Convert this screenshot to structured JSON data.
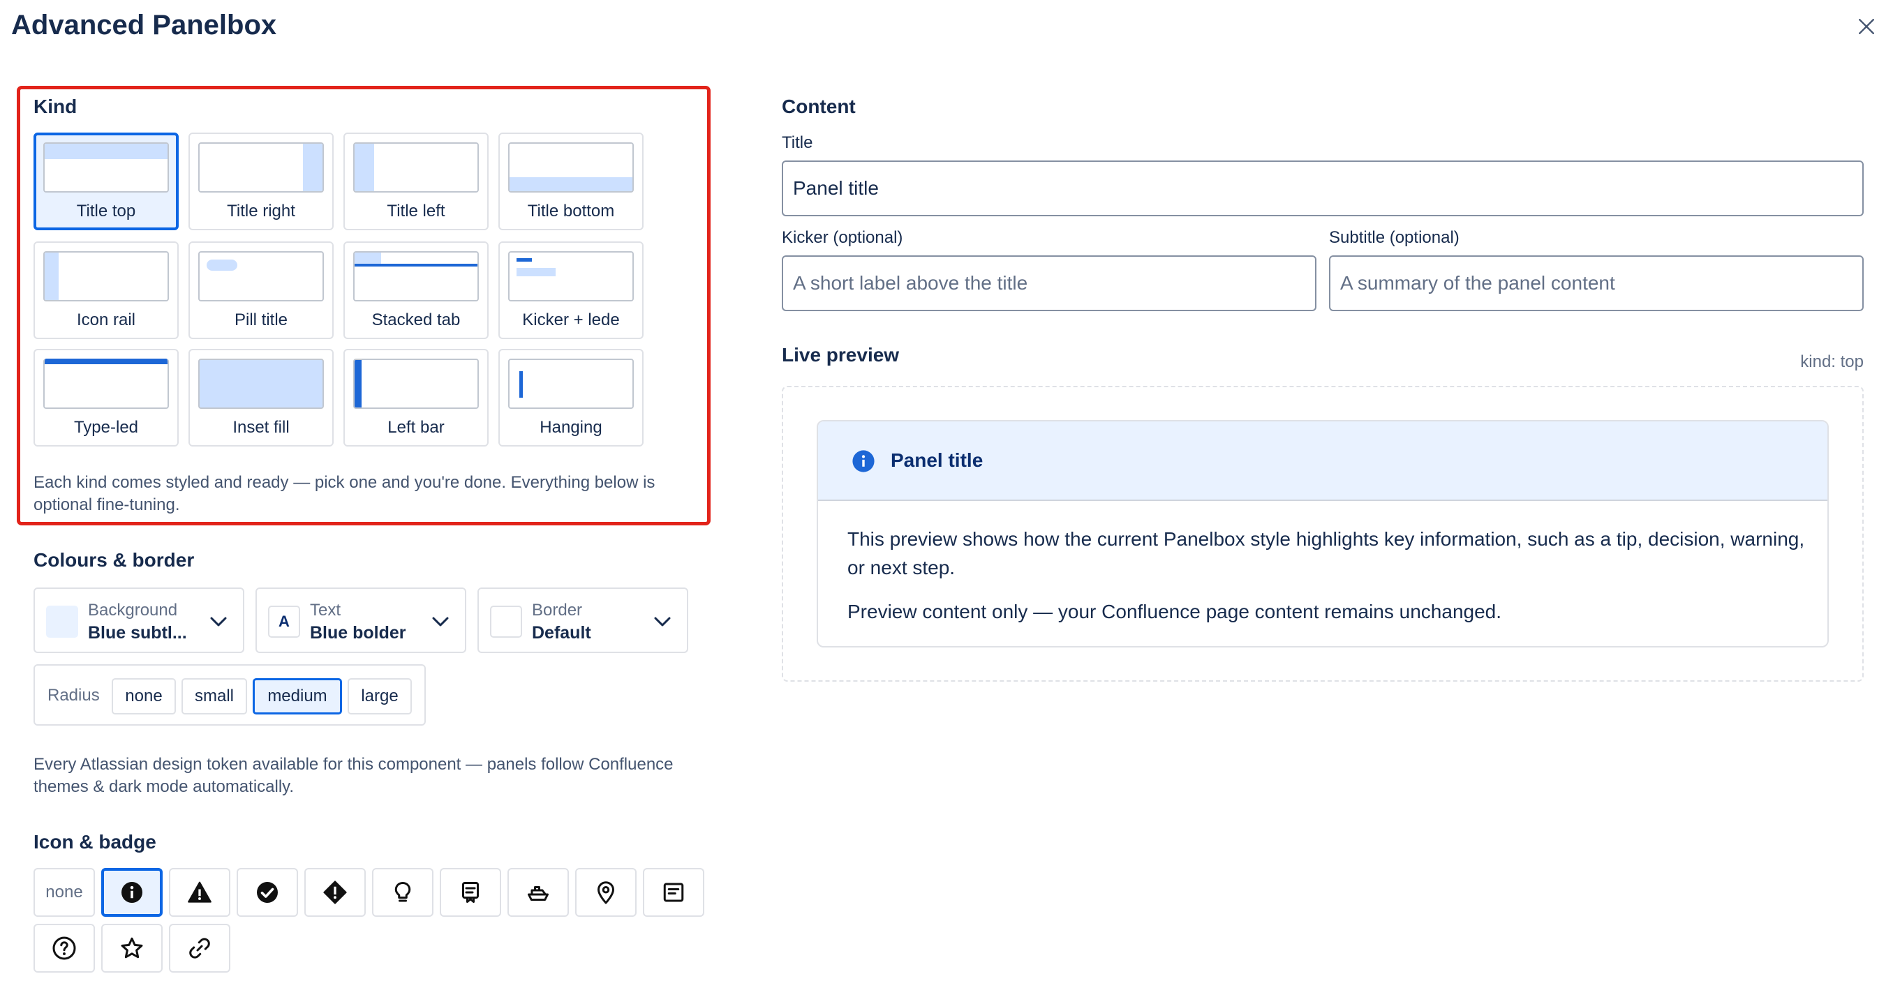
{
  "dialog": {
    "title": "Advanced Panelbox",
    "close_icon": "close-icon"
  },
  "kind": {
    "heading": "Kind",
    "options": [
      {
        "label": "Title top",
        "selected": true
      },
      {
        "label": "Title right",
        "selected": false
      },
      {
        "label": "Title left",
        "selected": false
      },
      {
        "label": "Title bottom",
        "selected": false
      },
      {
        "label": "Icon rail",
        "selected": false
      },
      {
        "label": "Pill title",
        "selected": false
      },
      {
        "label": "Stacked tab",
        "selected": false
      },
      {
        "label": "Kicker + lede",
        "selected": false
      },
      {
        "label": "Type-led",
        "selected": false
      },
      {
        "label": "Inset fill",
        "selected": false
      },
      {
        "label": "Left bar",
        "selected": false
      },
      {
        "label": "Hanging",
        "selected": false
      }
    ],
    "help": "Each kind comes styled and ready — pick one and you're done. Everything below is optional fine-tuning."
  },
  "colours": {
    "heading": "Colours & border",
    "background": {
      "caption": "Background",
      "value": "Blue subtl...",
      "swatch": "#E9F2FF"
    },
    "text": {
      "caption": "Text",
      "value": "Blue bolder",
      "glyph": "A",
      "glyph_color": "#0B2E70"
    },
    "border": {
      "caption": "Border",
      "value": "Default",
      "swatch": "#FFFFFF"
    },
    "radius": {
      "label": "Radius",
      "options": [
        "none",
        "small",
        "medium",
        "large"
      ],
      "selected": "medium"
    },
    "help": "Every Atlassian design token available for this component — panels follow Confluence themes & dark mode automatically."
  },
  "icon_badge": {
    "heading": "Icon & badge",
    "none_label": "none",
    "icons": [
      "info-icon",
      "warning-icon",
      "check-circle-icon",
      "error-diamond-icon",
      "lightbulb-icon",
      "feedback-icon",
      "ship-icon",
      "location-pin-icon",
      "note-icon",
      "question-icon",
      "star-icon",
      "link-icon"
    ],
    "selected": "info-icon"
  },
  "content": {
    "heading": "Content",
    "title_label": "Title",
    "title_value": "Panel title",
    "kicker_label": "Kicker (optional)",
    "kicker_placeholder": "A short label above the title",
    "subtitle_label": "Subtitle (optional)",
    "subtitle_placeholder": "A summary of the panel content"
  },
  "preview": {
    "heading": "Live preview",
    "kind_meta": "kind: top",
    "panel_title": "Panel title",
    "body_1": "This preview shows how the current Panelbox style highlights key information, such as a tip, decision, warning, or next step.",
    "body_2": "Preview content only — your Confluence page content remains unchanged."
  },
  "colors": {
    "accent": "#0C66E4",
    "selection_bg": "#E9F2FF",
    "highlight_border": "#E2231A"
  }
}
